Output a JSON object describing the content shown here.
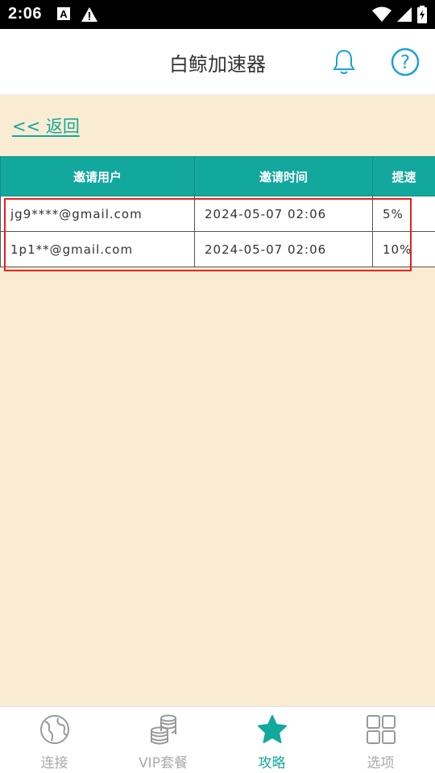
{
  "status_bar": {
    "time": "2:06"
  },
  "app_bar": {
    "title": "白鲸加速器"
  },
  "back_link": "<< 返回",
  "table": {
    "headers": [
      "邀请用户",
      "邀请时间",
      "提速"
    ],
    "rows": [
      [
        "jg9****@gmail.com",
        "2024-05-07 02:06",
        "5%"
      ],
      [
        "1p1**@gmail.com",
        "2024-05-07 02:06",
        "10%"
      ]
    ]
  },
  "tabs": [
    {
      "label": "连接",
      "icon": "globe-icon",
      "active": false
    },
    {
      "label": "VIP套餐",
      "icon": "coins-icon",
      "active": false
    },
    {
      "label": "攻略",
      "icon": "star-icon",
      "active": true
    },
    {
      "label": "选项",
      "icon": "grid-icon",
      "active": false
    }
  ],
  "colors": {
    "accent": "#13a89e",
    "background": "#faecd3",
    "highlight": "#e82020"
  }
}
